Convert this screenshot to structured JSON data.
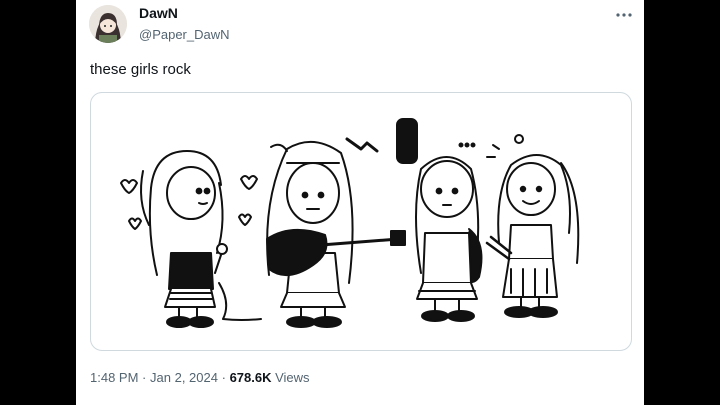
{
  "author": {
    "display_name": "DawN",
    "handle": "@Paper_DawN",
    "avatar_icon": "avatar-illustration"
  },
  "tweet": {
    "text": "these girls rock",
    "media_icon": "comic-illustration-four-girls-band"
  },
  "meta": {
    "time": "1:48 PM",
    "separator": "·",
    "date": "Jan 2, 2024",
    "views_count": "678.6K",
    "views_label": "Views"
  },
  "actions": {
    "more_icon": "more-dots-icon"
  },
  "colors": {
    "background": "#000000",
    "card": "#ffffff",
    "text_primary": "#0f1419",
    "text_secondary": "#536471",
    "border": "#cfd9de"
  }
}
